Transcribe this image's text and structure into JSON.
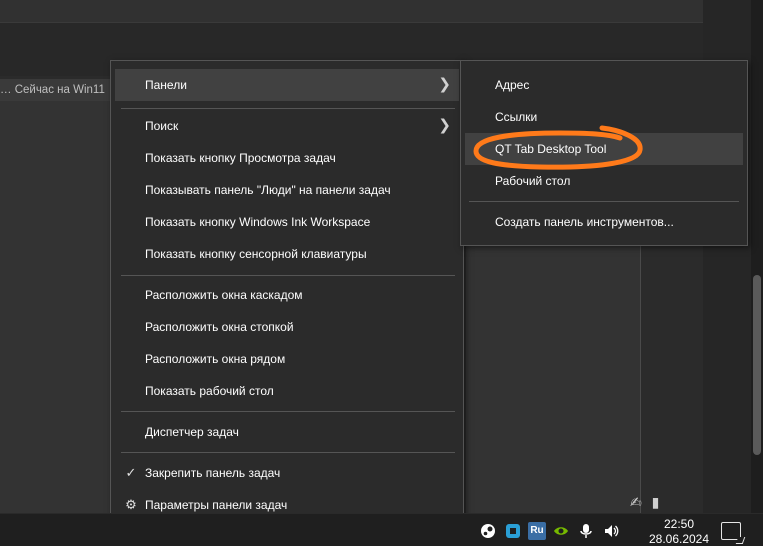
{
  "background": {
    "tab_text": "… Сейчас на Win11"
  },
  "context_menu": {
    "items": [
      {
        "label": "Панели",
        "has_submenu": true
      },
      {
        "label": "Поиск",
        "has_submenu": true
      },
      {
        "label": "Показать кнопку Просмотра задач"
      },
      {
        "label": "Показывать панель \"Люди\" на панели задач"
      },
      {
        "label": "Показать кнопку Windows Ink Workspace"
      },
      {
        "label": "Показать кнопку сенсорной клавиатуры"
      },
      {
        "label": "Расположить окна каскадом"
      },
      {
        "label": "Расположить окна стопкой"
      },
      {
        "label": "Расположить окна рядом"
      },
      {
        "label": "Показать рабочий стол"
      },
      {
        "label": "Диспетчер задач"
      },
      {
        "label": "Закрепить панель задач",
        "checked": true
      },
      {
        "label": "Параметры панели задач"
      }
    ]
  },
  "submenu": {
    "items": [
      {
        "label": "Адрес"
      },
      {
        "label": "Ссылки"
      },
      {
        "label": "QT Tab Desktop Tool"
      },
      {
        "label": "Рабочий стол"
      },
      {
        "label": "Создать панель инструментов..."
      }
    ]
  },
  "taskbar": {
    "language": "Ru",
    "time": "22:50",
    "date": "28.06.2024",
    "tray_icons": [
      "steam-icon",
      "app-icon",
      "language-icon",
      "nvidia-icon",
      "microphone-icon",
      "volume-icon"
    ]
  },
  "colors": {
    "menu_bg": "#2b2b2b",
    "hover_bg": "#414141",
    "highlight": "#ff7a1a"
  }
}
